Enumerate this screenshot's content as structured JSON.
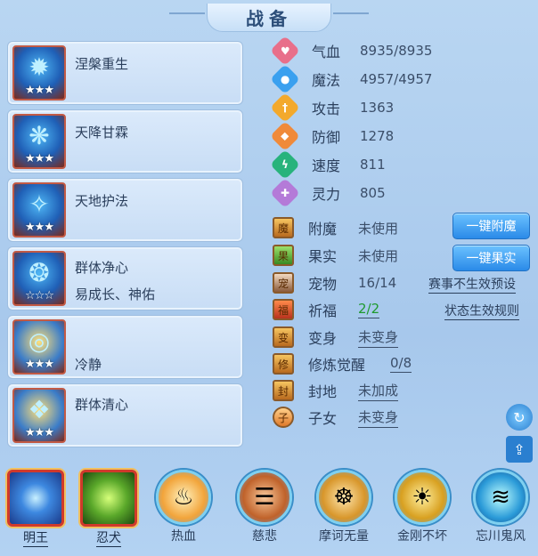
{
  "title": "战备",
  "skills": [
    {
      "name": "涅槃重生",
      "stars": "★★★",
      "glyph": "✹"
    },
    {
      "name": "天降甘霖",
      "stars": "★★★",
      "glyph": "❋"
    },
    {
      "name": "天地护法",
      "stars": "★★★",
      "glyph": "✧"
    },
    {
      "name": "群体净心",
      "sub": "易成长、神佑",
      "stars": "☆☆☆",
      "glyph": "❂"
    },
    {
      "name": "冷静",
      "stars": "★★★",
      "glyph": "◎"
    },
    {
      "name": "群体清心",
      "stars": "★★★",
      "glyph": "❖"
    }
  ],
  "attributes": [
    {
      "label": "气血",
      "value": "8935/8935",
      "icon": "heart-icon",
      "color": "#e86f8a"
    },
    {
      "label": "魔法",
      "value": "4957/4957",
      "icon": "mana-icon",
      "color": "#3aa0ef"
    },
    {
      "label": "攻击",
      "value": "1363",
      "icon": "sword-icon",
      "color": "#f3a92c"
    },
    {
      "label": "防御",
      "value": "1278",
      "icon": "shield-icon",
      "color": "#f08a3a"
    },
    {
      "label": "速度",
      "value": "811",
      "icon": "speed-icon",
      "color": "#28b37c"
    },
    {
      "label": "灵力",
      "value": "805",
      "icon": "spirit-icon",
      "color": "#b47ad8"
    }
  ],
  "features": {
    "enchant": {
      "label": "附魔",
      "value": "未使用"
    },
    "fruit": {
      "label": "果实",
      "value": "未使用"
    },
    "pet": {
      "label": "宠物",
      "value": "16/14"
    },
    "blessing": {
      "label": "祈福",
      "value": "2/2"
    },
    "transform": {
      "label": "变身",
      "value": "未变身"
    },
    "awaken": {
      "label": "修炼觉醒",
      "value": "0/8"
    },
    "land": {
      "label": "封地",
      "value": "未加成"
    },
    "children": {
      "label": "子女",
      "value": "未变身"
    }
  },
  "buttons": {
    "enchant": "一键附魔",
    "fruit": "一键果实"
  },
  "links": {
    "event_preset": "赛事不生效预设",
    "status_rule": "状态生效规则"
  },
  "pets": [
    {
      "name": "明王",
      "selected": true
    },
    {
      "name": "忍犬",
      "selected": true
    },
    {
      "name": "热血"
    },
    {
      "name": "慈悲"
    },
    {
      "name": "摩诃无量"
    },
    {
      "name": "金刚不坏"
    },
    {
      "name": "忘川鬼风"
    }
  ]
}
